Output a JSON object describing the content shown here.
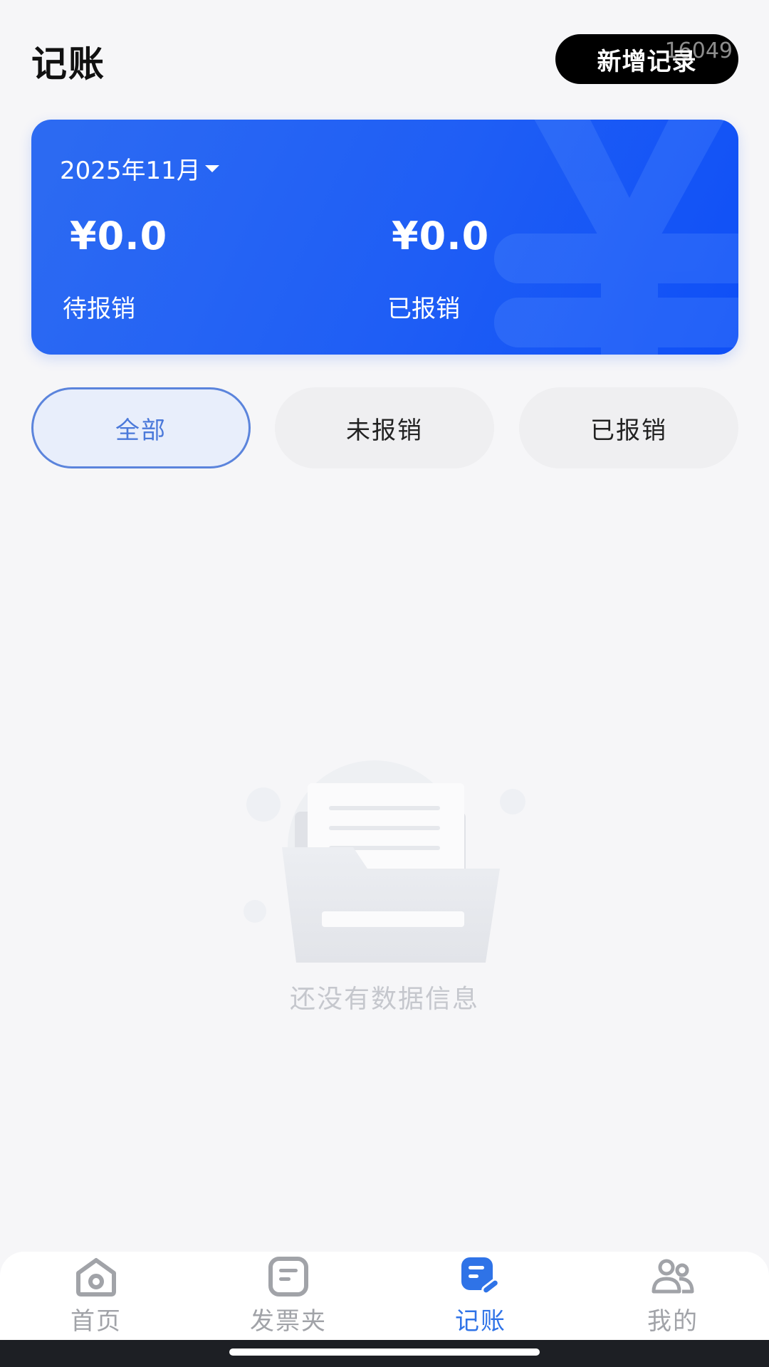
{
  "header": {
    "title": "记账",
    "add_button_label": "新增记录",
    "overlay_counter": "16049"
  },
  "summary": {
    "month": "2025年11月",
    "pending_amount": "¥0.0",
    "pending_label": "待报销",
    "reimbursed_amount": "¥0.0",
    "reimbursed_label": "已报销"
  },
  "filters": {
    "tabs": [
      {
        "label": "全部",
        "active": true
      },
      {
        "label": "未报销",
        "active": false
      },
      {
        "label": "已报销",
        "active": false
      }
    ]
  },
  "empty_state": {
    "message": "还没有数据信息"
  },
  "bottom_nav": {
    "items": [
      {
        "label": "首页",
        "icon": "home-eye-icon",
        "active": false
      },
      {
        "label": "发票夹",
        "icon": "invoice-folder-icon",
        "active": false
      },
      {
        "label": "记账",
        "icon": "ledger-edit-icon",
        "active": true
      },
      {
        "label": "我的",
        "icon": "users-icon",
        "active": false
      }
    ]
  },
  "colors": {
    "card_gradient_start": "#2d6bf2",
    "card_gradient_end": "#0f4ff6",
    "active_tab_border": "#5b84dc",
    "active_nav": "#2f73e7",
    "inactive_nav": "#a1a3a8"
  }
}
